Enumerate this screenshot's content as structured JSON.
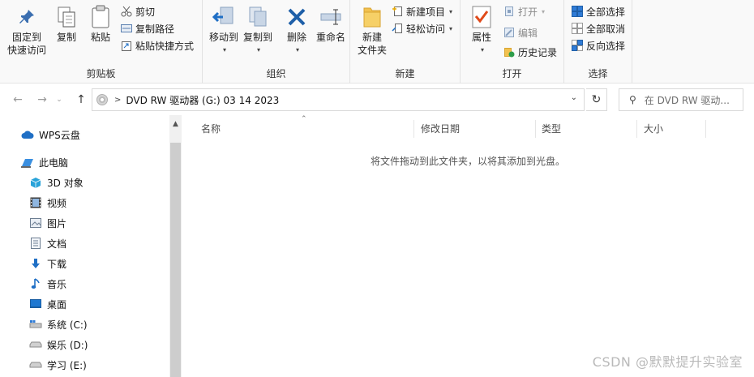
{
  "ribbon": {
    "clipboard": {
      "label": "剪贴板",
      "pin_line1": "固定到",
      "pin_line2": "快速访问",
      "copy": "复制",
      "paste": "粘贴",
      "cut": "剪切",
      "copy_path": "复制路径",
      "paste_shortcut": "粘贴快捷方式"
    },
    "organize": {
      "label": "组织",
      "move_to": "移动到",
      "copy_to": "复制到",
      "delete": "删除",
      "rename": "重命名"
    },
    "new": {
      "label": "新建",
      "new_folder_line1": "新建",
      "new_folder_line2": "文件夹",
      "new_item": "新建项目",
      "easy_access": "轻松访问"
    },
    "open": {
      "label": "打开",
      "properties": "属性",
      "open": "打开",
      "edit": "编辑",
      "history": "历史记录"
    },
    "select": {
      "label": "选择",
      "select_all": "全部选择",
      "select_none": "全部取消",
      "invert": "反向选择"
    }
  },
  "address": {
    "path": "DVD RW 驱动器 (G:) 03 14 2023",
    "search_placeholder": "在 DVD RW 驱动..."
  },
  "nav": {
    "items": [
      {
        "label": "WPS云盘",
        "icon": "cloud-icon"
      },
      {
        "label": "此电脑",
        "icon": "computer-icon"
      },
      {
        "label": "3D 对象",
        "icon": "cube-icon"
      },
      {
        "label": "视频",
        "icon": "video-icon"
      },
      {
        "label": "图片",
        "icon": "picture-icon"
      },
      {
        "label": "文档",
        "icon": "document-icon"
      },
      {
        "label": "下载",
        "icon": "download-icon"
      },
      {
        "label": "音乐",
        "icon": "music-icon"
      },
      {
        "label": "桌面",
        "icon": "desktop-icon"
      },
      {
        "label": "系统 (C:)",
        "icon": "drive-icon"
      },
      {
        "label": "娱乐 (D:)",
        "icon": "drive-icon"
      },
      {
        "label": "学习 (E:)",
        "icon": "drive-icon"
      }
    ]
  },
  "content": {
    "columns": [
      "名称",
      "修改日期",
      "类型",
      "大小"
    ],
    "empty_message": "将文件拖动到此文件夹，以将其添加到光盘。",
    "watermark": "CSDN @默默提升实验室"
  },
  "colors": {
    "accent_blue": "#1f6fc5",
    "folder_yellow": "#f2c14e",
    "delete_blue": "#1e5fa8"
  }
}
